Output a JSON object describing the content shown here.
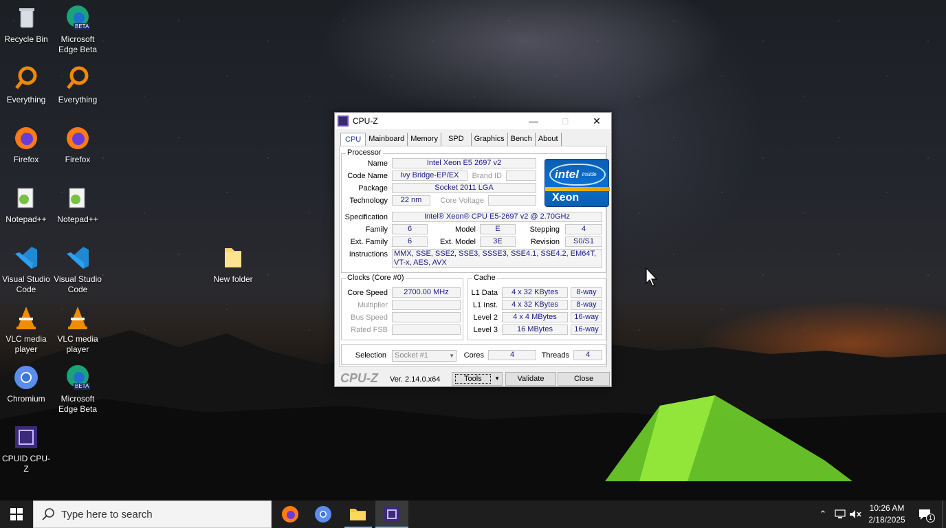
{
  "desktop": {
    "icons": [
      {
        "label": "Recycle Bin"
      },
      {
        "label": "Microsoft Edge Beta"
      },
      {
        "label": "Everything"
      },
      {
        "label": "Everything"
      },
      {
        "label": "Firefox"
      },
      {
        "label": "Firefox"
      },
      {
        "label": "Notepad++"
      },
      {
        "label": "Notepad++"
      },
      {
        "label": "Visual Studio Code"
      },
      {
        "label": "Visual Studio Code"
      },
      {
        "label": "VLC media player"
      },
      {
        "label": "VLC media player"
      },
      {
        "label": "Chromium"
      },
      {
        "label": "Microsoft Edge Beta"
      },
      {
        "label": "CPUID CPU-Z"
      },
      {
        "label": "New folder"
      }
    ],
    "edge_badge": "BETA"
  },
  "window": {
    "title": "CPU-Z",
    "tabs": [
      "CPU",
      "Mainboard",
      "Memory",
      "SPD",
      "Graphics",
      "Bench",
      "About"
    ],
    "active_tab": "CPU",
    "processor": {
      "legend": "Processor",
      "name_label": "Name",
      "name": "Intel Xeon E5 2697 v2",
      "codename_label": "Code Name",
      "codename": "Ivy Bridge-EP/EX",
      "brandid_label": "Brand ID",
      "package_label": "Package",
      "package": "Socket 2011 LGA",
      "technology_label": "Technology",
      "technology": "22 nm",
      "corevoltage_label": "Core Voltage",
      "spec_label": "Specification",
      "spec": "Intel® Xeon® CPU E5-2697 v2 @ 2.70GHz",
      "family_label": "Family",
      "family": "6",
      "model_label": "Model",
      "model": "E",
      "stepping_label": "Stepping",
      "stepping": "4",
      "extfamily_label": "Ext. Family",
      "extfamily": "6",
      "extmodel_label": "Ext. Model",
      "extmodel": "3E",
      "revision_label": "Revision",
      "revision": "S0/S1",
      "instructions_label": "Instructions",
      "instructions": "MMX, SSE, SSE2, SSE3, SSSE3, SSE4.1, SSE4.2, EM64T, VT-x, AES, AVX"
    },
    "logo": {
      "brand": "intel",
      "inside": "inside",
      "product": "Xeon"
    },
    "clocks": {
      "legend": "Clocks (Core #0)",
      "corespeed_label": "Core Speed",
      "corespeed": "2700.00 MHz",
      "multiplier_label": "Multiplier",
      "busspeed_label": "Bus Speed",
      "ratedfsb_label": "Rated FSB"
    },
    "cache": {
      "legend": "Cache",
      "rows": [
        {
          "label": "L1 Data",
          "size": "4 x 32 KBytes",
          "way": "8-way"
        },
        {
          "label": "L1 Inst.",
          "size": "4 x 32 KBytes",
          "way": "8-way"
        },
        {
          "label": "Level 2",
          "size": "4 x 4 MBytes",
          "way": "16-way"
        },
        {
          "label": "Level 3",
          "size": "16 MBytes",
          "way": "16-way"
        }
      ]
    },
    "selection": {
      "label": "Selection",
      "value": "Socket #1",
      "cores_label": "Cores",
      "cores": "4",
      "threads_label": "Threads",
      "threads": "4"
    },
    "footer": {
      "brand": "CPU-Z",
      "version": "Ver. 2.14.0.x64",
      "tools": "Tools",
      "validate": "Validate",
      "close": "Close"
    }
  },
  "taskbar": {
    "search_placeholder": "Type here to search",
    "time": "10:26 AM",
    "date": "2/18/2025",
    "notification_count": "1"
  }
}
